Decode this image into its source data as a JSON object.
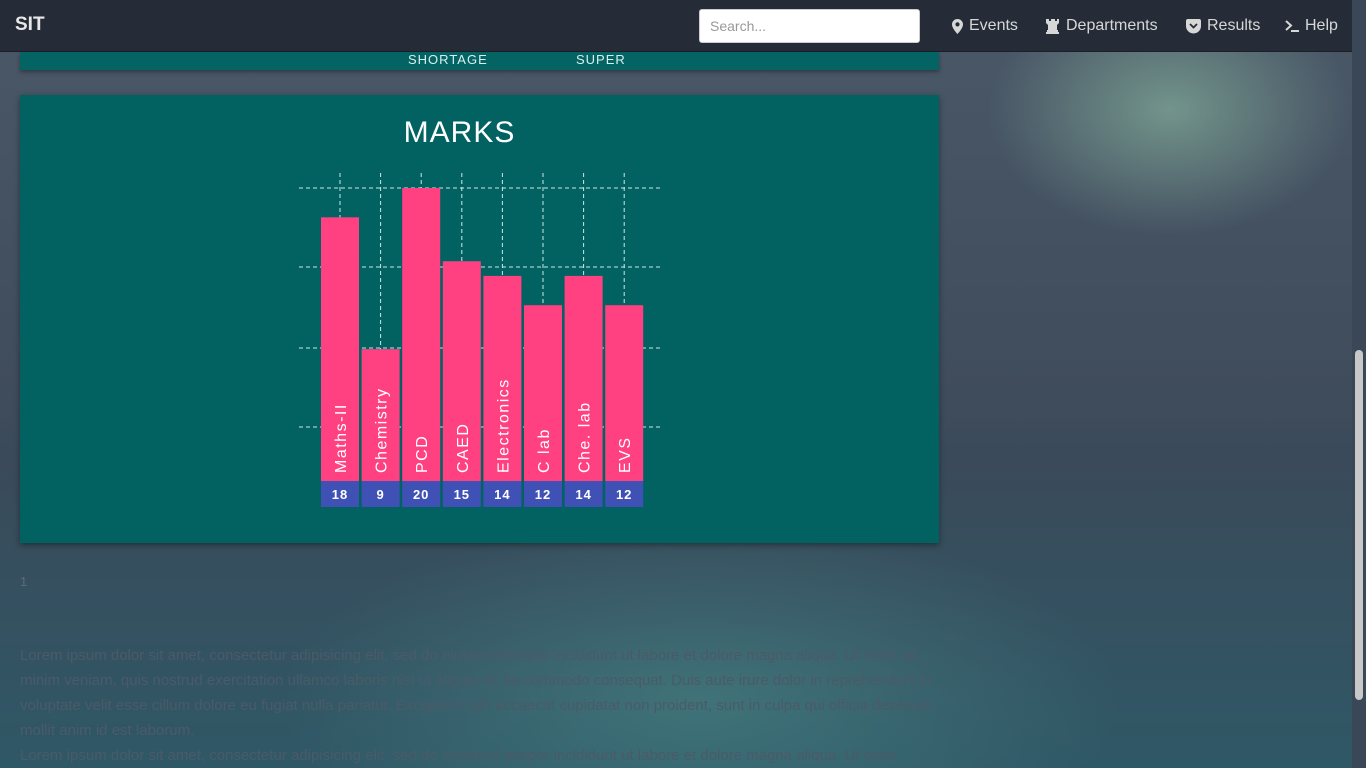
{
  "navbar": {
    "brand": "SIT",
    "search_placeholder": "Search...",
    "items": [
      {
        "label": "Events",
        "icon": "map-marker-icon"
      },
      {
        "label": "Departments",
        "icon": "chess-rook-icon"
      },
      {
        "label": "Results",
        "icon": "pocket-icon"
      },
      {
        "label": "Help",
        "icon": "terminal-icon"
      }
    ]
  },
  "top_card": {
    "labels": [
      "SHORTAGE",
      "SUPER"
    ]
  },
  "marks_card": {
    "title": "MARKS"
  },
  "chart_data": {
    "type": "bar",
    "title": "MARKS",
    "categories": [
      "Maths-II",
      "Chemistry",
      "PCD",
      "CAED",
      "Electronics",
      "C lab",
      "Che. lab",
      "EVS"
    ],
    "values": [
      18,
      9,
      20,
      15,
      14,
      12,
      14,
      12
    ],
    "ylim": [
      0,
      20
    ],
    "grid": true,
    "colors": {
      "bar": "#ff4081",
      "value_box": "#3f51b5",
      "grid": "#cfe6e6",
      "card": "#026262"
    }
  },
  "page_number": "1",
  "paragraphs": [
    "Lorem ipsum dolor sit amet, consectetur adipisicing elit, sed do eiusmod tempor incididunt ut labore et dolore magna aliqua. Ut enim ad minim veniam, quis nostrud exercitation ullamco laboris nisi ut aliquip ex ea commodo consequat. Duis aute irure dolor in reprehenderit in voluptate velit esse cillum dolore eu fugiat nulla pariatur. Excepteur sint occaecat cupidatat non proident, sunt in culpa qui officia deserunt mollit anim id est laborum.",
    "Lorem ipsum dolor sit amet, consectetur adipisicing elit, sed do eiusmod tempor incididunt ut labore et dolore magna aliqua. Ut enim"
  ]
}
